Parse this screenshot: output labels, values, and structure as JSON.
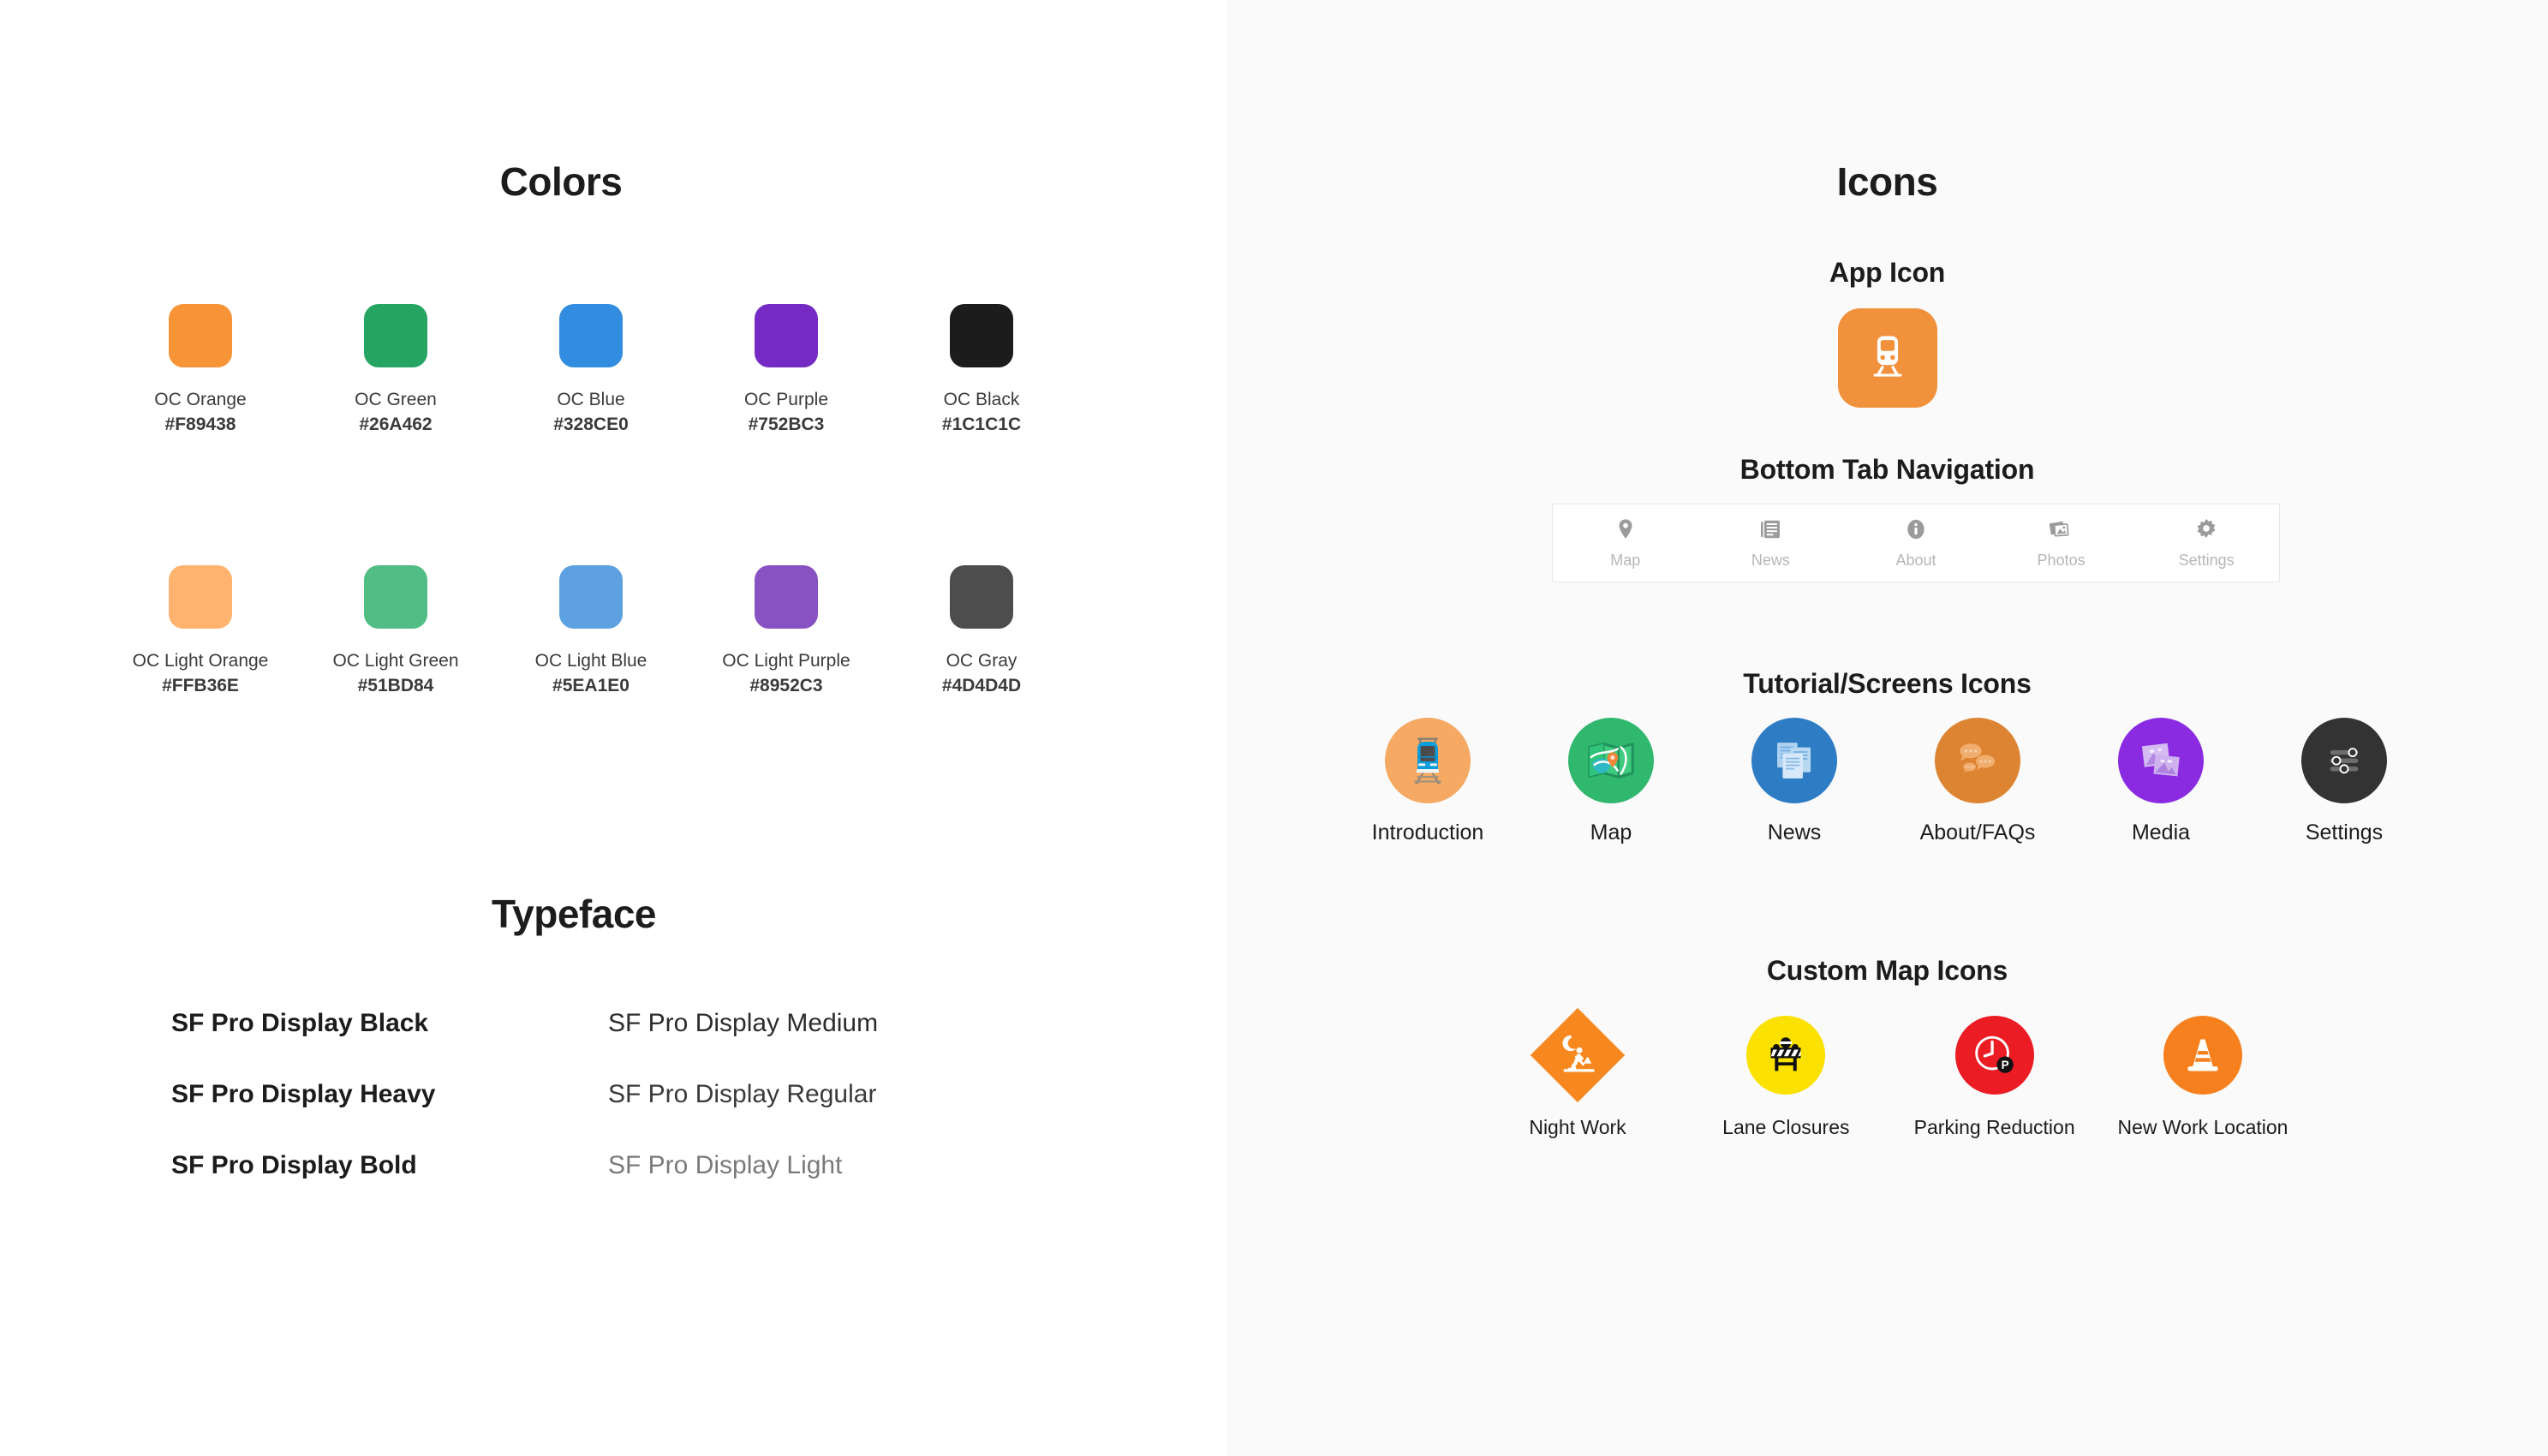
{
  "left": {
    "colors": {
      "heading": "Colors",
      "swatches_row1": [
        {
          "name": "OC Orange",
          "hex": "#F89438"
        },
        {
          "name": "OC Green",
          "hex": "#26A462"
        },
        {
          "name": "OC Blue",
          "hex": "#328CE0"
        },
        {
          "name": "OC Purple",
          "hex": "#752BC3"
        },
        {
          "name": "OC Black",
          "hex": "#1C1C1C"
        }
      ],
      "swatches_row2": [
        {
          "name": "OC Light Orange",
          "hex": "#FFB36E"
        },
        {
          "name": "OC Light Green",
          "hex": "#51BD84"
        },
        {
          "name": "OC Light Blue",
          "hex": "#5EA1E0"
        },
        {
          "name": "OC Light Purple",
          "hex": "#8952C3"
        },
        {
          "name": "OC Gray",
          "hex": "#4D4D4D"
        }
      ]
    },
    "typeface": {
      "heading": "Typeface",
      "items": [
        "SF Pro Display Black",
        "SF Pro Display Medium",
        "SF Pro Display Heavy",
        "SF Pro Display Regular",
        "SF Pro Display Bold",
        "SF Pro Display Light"
      ]
    }
  },
  "right": {
    "heading": "Icons",
    "app_icon": {
      "heading": "App Icon",
      "background": "#F2913C",
      "glyph": "train-icon"
    },
    "tab_nav": {
      "heading": "Bottom Tab Navigation",
      "tabs": [
        {
          "label": "Map",
          "icon": "map-pin-icon"
        },
        {
          "label": "News",
          "icon": "newspaper-icon"
        },
        {
          "label": "About",
          "icon": "info-circle-icon"
        },
        {
          "label": "Photos",
          "icon": "photos-stack-icon"
        },
        {
          "label": "Settings",
          "icon": "gear-icon"
        }
      ],
      "icon_color": "#9B9B9B",
      "label_color": "#B6B6B6"
    },
    "tutorial": {
      "heading": "Tutorial/Screens Icons",
      "items": [
        {
          "label": "Introduction",
          "icon": "train-front-icon",
          "background": "#F5A962"
        },
        {
          "label": "Map",
          "icon": "folded-map-icon",
          "background": "#2FB86E"
        },
        {
          "label": "News",
          "icon": "documents-icon",
          "background": "#2E7CC4"
        },
        {
          "label": "About/FAQs",
          "icon": "chat-bubbles-icon",
          "background": "#DD8432"
        },
        {
          "label": "Media",
          "icon": "photos-icon",
          "background": "#8A2BE2"
        },
        {
          "label": "Settings",
          "icon": "sliders-icon",
          "background": "#333333"
        }
      ]
    },
    "map_icons": {
      "heading": "Custom Map Icons",
      "items": [
        {
          "label": "Night Work",
          "icon": "night-work-icon",
          "shape": "diamond",
          "background": "#F7881F"
        },
        {
          "label": "Lane Closures",
          "icon": "barricade-icon",
          "shape": "circle",
          "background": "#FAE100"
        },
        {
          "label": "Parking Reduction",
          "icon": "clock-parking-icon",
          "shape": "circle",
          "background": "#EC1C24"
        },
        {
          "label": "New Work Location",
          "icon": "traffic-cone-icon",
          "shape": "circle",
          "background": "#F7801E"
        }
      ]
    }
  }
}
